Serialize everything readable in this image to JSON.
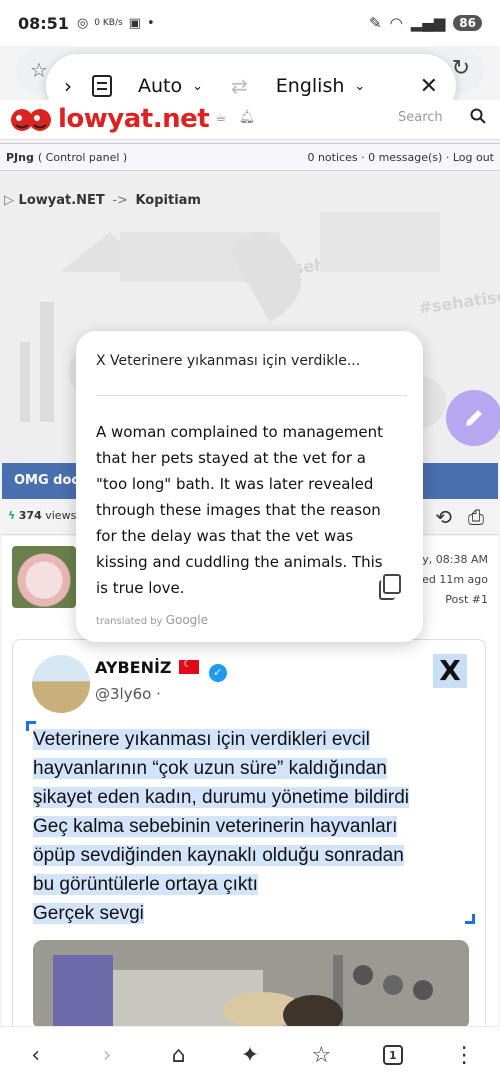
{
  "status_bar": {
    "time": "08:51",
    "net_speed": "0 KB/s",
    "battery": "86"
  },
  "translate_bar": {
    "source_lang": "Auto",
    "target_lang": "English"
  },
  "site": {
    "logo_text": "lowyat.net",
    "search_placeholder": "Search"
  },
  "control_bar": {
    "user": "PJng",
    "control_panel": "( Control panel )",
    "notices": "0 notices",
    "messages": "0 message(s)",
    "logout": "Log out"
  },
  "breadcrumb": {
    "home": "Lowyat.NET",
    "arrow": "->",
    "forum": "Kopitiam"
  },
  "background": {
    "hashtag_1": "#sehatisejiwa",
    "hashtag_2": "#sehatisejiwa"
  },
  "thread": {
    "title": "OMG doc",
    "views_count": "374",
    "views_label": "views"
  },
  "post": {
    "date": "ay, 08:38 AM",
    "edited": "ted 11m ago",
    "post_number": "Post #1"
  },
  "tweet": {
    "name": "AYBENİZ",
    "handle": "@3ly6o",
    "dot": "·",
    "x_logo": "X",
    "text_lines": [
      "Veterinere yıkanması için verdikleri evcil",
      "hayvanlarının “çok uzun süre” kaldığından",
      "şikayet eden kadın, durumu yönetime bildirdi",
      "Geç kalma sebebinin veterinerin hayvanları",
      "öpüp sevdiğinden kaynaklı olduğu sonradan",
      "bu görüntülerle ortaya çıktı",
      "Gerçek sevgi"
    ]
  },
  "translation_popup": {
    "source_snippet": "X Veterinere yıkanması için verdikle...",
    "translated_text": "A woman complained to management that her pets stayed at the vet for a \"too long\" bath. It was later revealed through these images that the reason for the delay was that the vet was kissing and cuddling the animals. This is true love.",
    "credit_prefix": "translated by",
    "credit_brand": "Google"
  },
  "bottom_nav": {
    "tabs_count": "1"
  },
  "colors": {
    "thread_bar": "#4a6fae",
    "selection": "#d3e3fa",
    "fab": "#b6a8f0",
    "logo_red": "#dd2222"
  }
}
